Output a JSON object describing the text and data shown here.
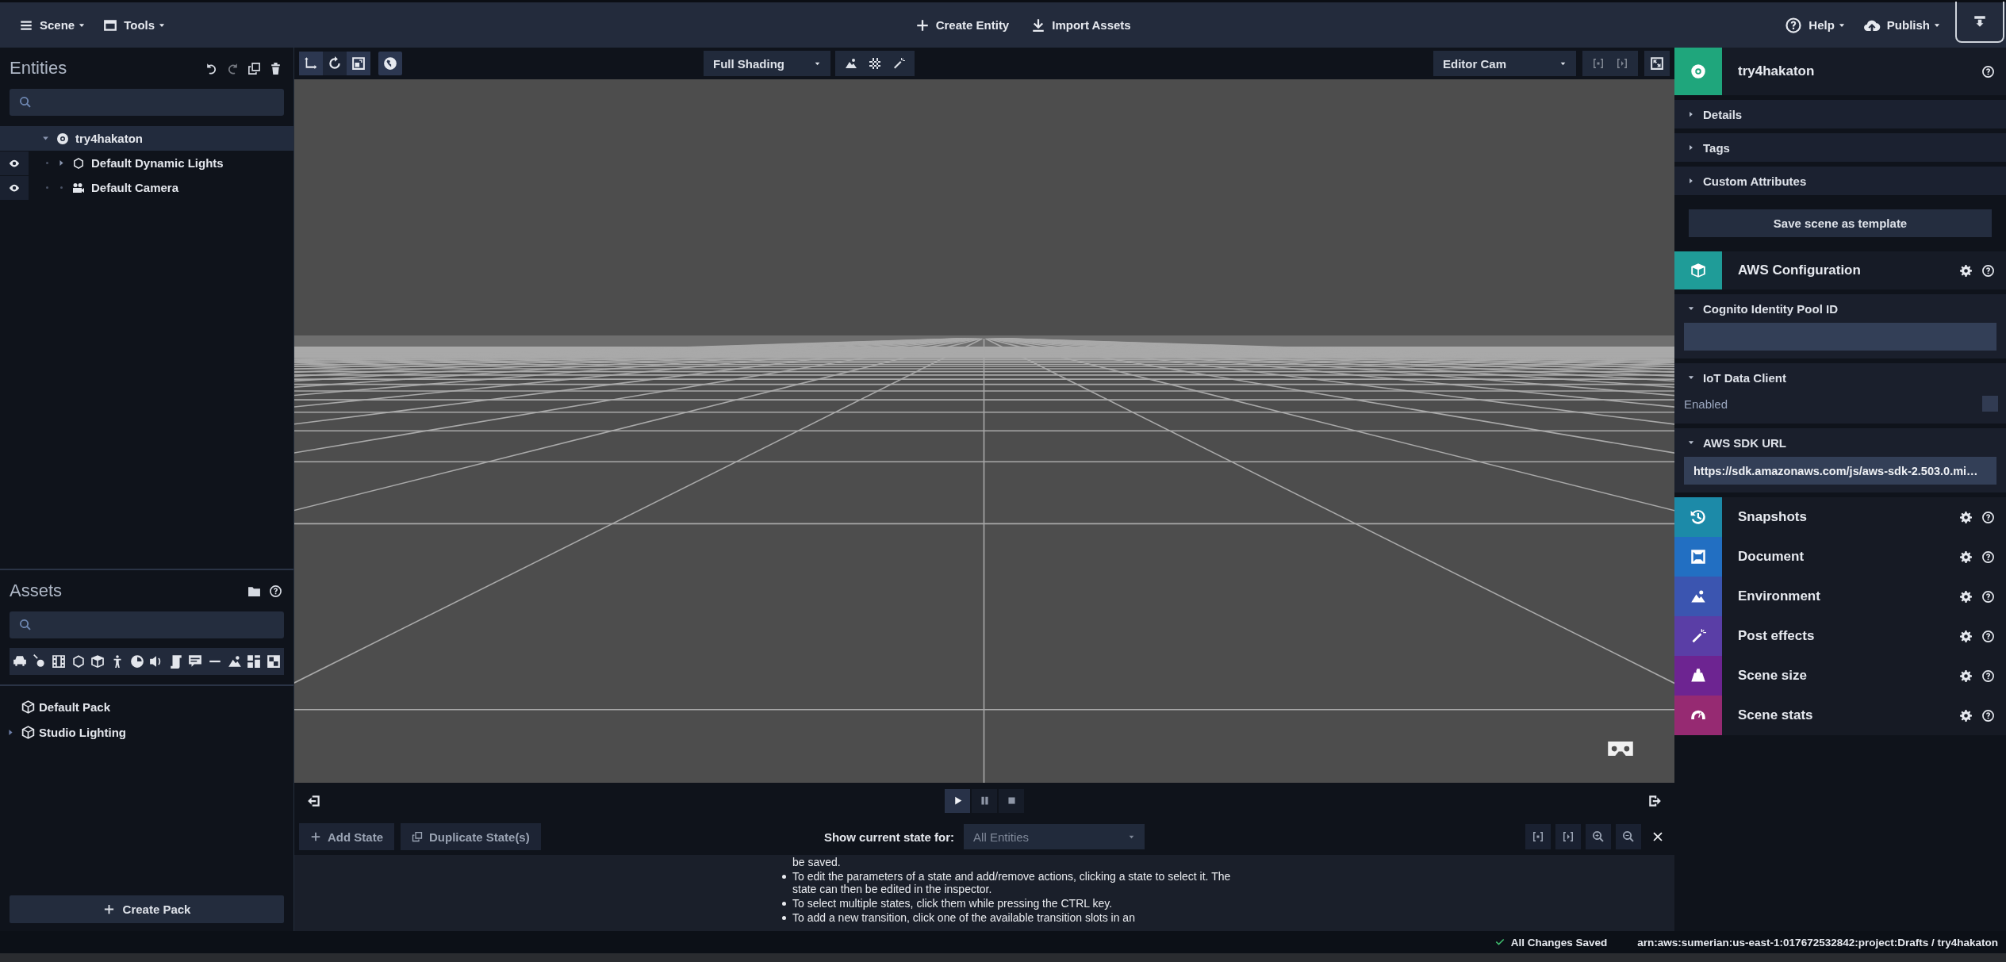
{
  "top_bar": {
    "menus": [
      {
        "label": "Scene"
      },
      {
        "label": "Tools"
      }
    ],
    "actions": [
      {
        "label": "Create Entity"
      },
      {
        "label": "Import Assets"
      }
    ],
    "right_menus": [
      {
        "label": "Help"
      },
      {
        "label": "Publish"
      }
    ]
  },
  "entities": {
    "title": "Entities",
    "tree": [
      {
        "label": "try4hakaton",
        "kind": "scene",
        "selected": true,
        "expanded": true,
        "children": [
          {
            "label": "Default Dynamic Lights",
            "kind": "group",
            "selected": false,
            "expandable": true,
            "expanded": false
          },
          {
            "label": "Default Camera",
            "kind": "camera",
            "selected": false,
            "expandable": false
          }
        ]
      }
    ]
  },
  "assets": {
    "title": "Assets",
    "packs": [
      {
        "label": "Default Pack",
        "expandable": false
      },
      {
        "label": "Studio Lighting",
        "expandable": true,
        "expanded": false
      }
    ],
    "create_button": "Create Pack"
  },
  "viewport": {
    "shading": "Full Shading",
    "camera": "Editor Cam"
  },
  "playback": [
    {
      "kind": "play",
      "selected": true
    },
    {
      "kind": "pause",
      "selected": false
    },
    {
      "kind": "stop",
      "selected": false
    }
  ],
  "state_machine": {
    "buttons": [
      "Add State",
      "Duplicate State(s)"
    ],
    "filter_label": "Show current state for:",
    "filter_value": "All Entities",
    "help_lines": [
      {
        "text": "be saved.",
        "bullet": false
      },
      {
        "text": "To edit the parameters of a state and add/remove actions, clicking a state to select it. The state can then be edited in the inspector.",
        "bullet": true
      },
      {
        "text": "To select multiple states, click them while pressing the CTRL key.",
        "bullet": true
      },
      {
        "text": "To add a new transition, click one of the available transition slots in an",
        "bullet": true
      }
    ]
  },
  "inspector": {
    "entity": {
      "name": "try4hakaton",
      "color": "#1fa67c"
    },
    "sections": [
      {
        "label": "Details",
        "expanded": false
      },
      {
        "label": "Tags",
        "expanded": false
      },
      {
        "label": "Custom Attributes",
        "expanded": false
      }
    ],
    "template_button": "Save scene as template",
    "aws_configuration": {
      "title": "AWS Configuration",
      "color": "#1f9c98",
      "fields": [
        {
          "kind": "input",
          "label": "Cognito Identity Pool ID",
          "expanded": true
        },
        {
          "kind": "checkbox",
          "label": "IoT Data Client",
          "expanded": true,
          "option": "Enabled",
          "checked": false
        },
        {
          "kind": "input",
          "label": "AWS SDK URL",
          "expanded": true,
          "value": "https://sdk.amazonaws.com/js/aws-sdk-2.503.0.mi…"
        }
      ]
    },
    "components": [
      {
        "name": "Snapshots",
        "color": "#1c8aa8"
      },
      {
        "name": "Document",
        "color": "#226fc2"
      },
      {
        "name": "Environment",
        "color": "#3b55b0"
      },
      {
        "name": "Post effects",
        "color": "#5a3ea6"
      },
      {
        "name": "Scene size",
        "color": "#6d2491"
      },
      {
        "name": "Scene stats",
        "color": "#962a72"
      }
    ]
  },
  "status_bar": {
    "saved": "All Changes Saved",
    "path": "arn:aws:sumerian:us-east-1:017672532842:project:Drafts / try4hakaton"
  }
}
